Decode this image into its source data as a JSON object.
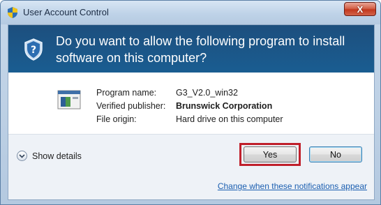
{
  "window": {
    "title": "User Account Control",
    "close_symbol": "X"
  },
  "header": {
    "question": "Do you want to allow the following program to install software on this computer?"
  },
  "details": {
    "program_name_label": "Program name:",
    "program_name_value": "G3_V2.0_win32",
    "publisher_label": "Verified publisher:",
    "publisher_value": "Brunswick Corporation",
    "origin_label": "File origin:",
    "origin_value": "Hard drive on this computer"
  },
  "footer": {
    "show_details_label": "Show details",
    "yes_label": "Yes",
    "no_label": "No",
    "change_link": "Change when these notifications appear"
  },
  "colors": {
    "header_bg": "#1d4f7e",
    "highlight": "#c0202b",
    "link": "#1a5eb0"
  },
  "icons": [
    "shield-icon",
    "program-icon",
    "chevron-down-icon",
    "close-icon"
  ]
}
